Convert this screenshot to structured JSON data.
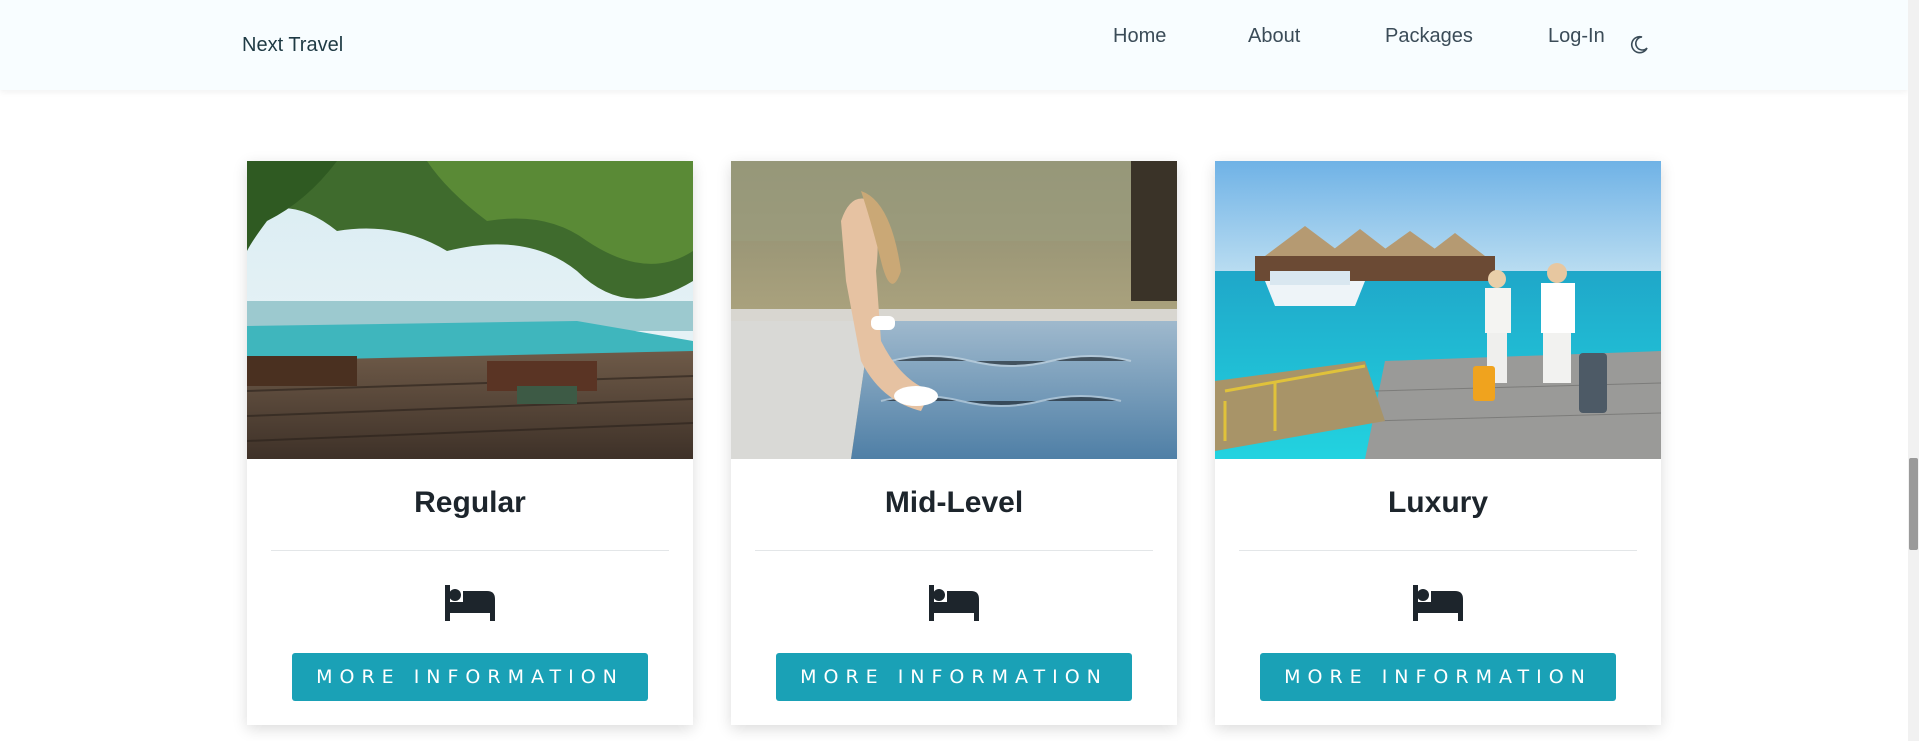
{
  "navbar": {
    "brand": "Next Travel",
    "links": [
      {
        "label": "Home"
      },
      {
        "label": "About"
      },
      {
        "label": "Packages"
      },
      {
        "label": "Log-In"
      }
    ],
    "theme_icon": "moon-icon"
  },
  "packages": [
    {
      "title": "Regular",
      "icon": "bed-icon",
      "button_label": "MORE INFORMATION"
    },
    {
      "title": "Mid-Level",
      "icon": "bed-icon",
      "button_label": "MORE INFORMATION"
    },
    {
      "title": "Luxury",
      "icon": "bed-icon",
      "button_label": "MORE INFORMATION"
    }
  ],
  "colors": {
    "accent": "#1aa1b6",
    "navbar_bg": "#f8fdff"
  }
}
